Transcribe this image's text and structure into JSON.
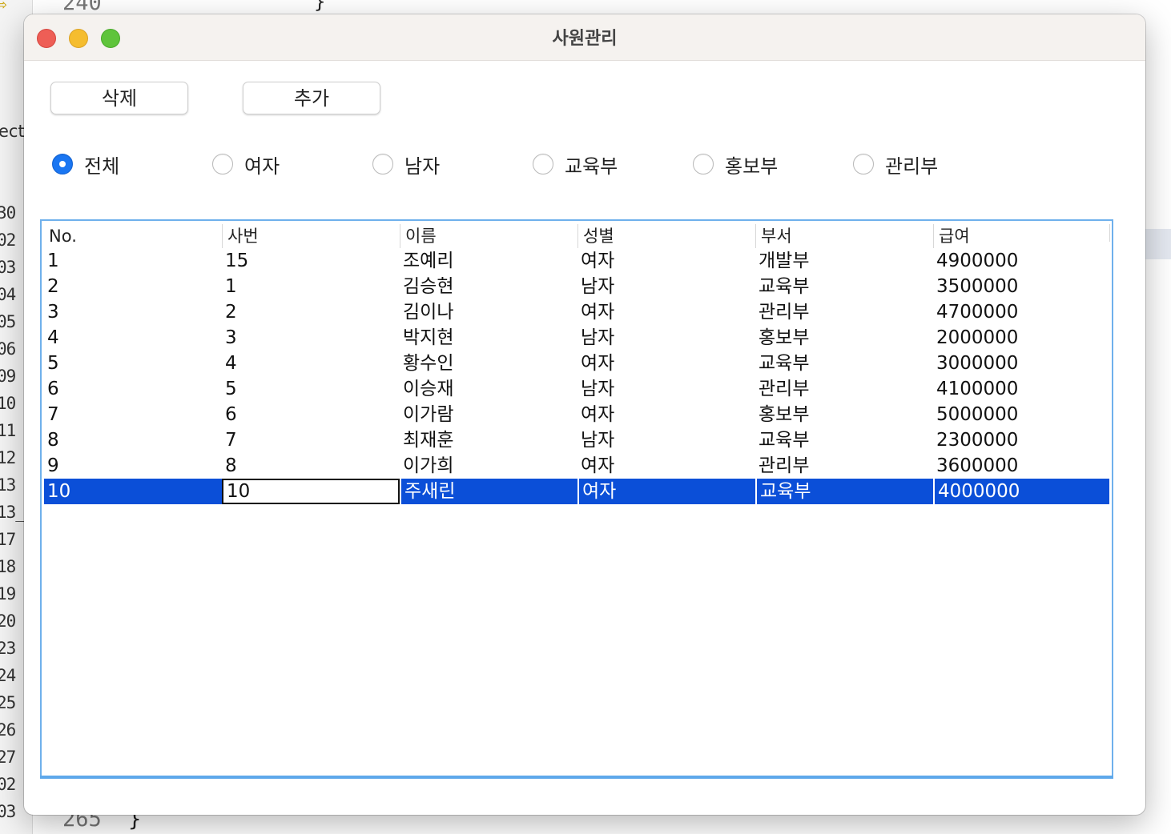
{
  "window": {
    "title": "사원관리"
  },
  "toolbar": {
    "delete_label": "삭제",
    "add_label": "추가"
  },
  "filters": [
    {
      "label": "전체",
      "checked": true
    },
    {
      "label": "여자",
      "checked": false
    },
    {
      "label": "남자",
      "checked": false
    },
    {
      "label": "교육부",
      "checked": false
    },
    {
      "label": "홍보부",
      "checked": false
    },
    {
      "label": "관리부",
      "checked": false
    }
  ],
  "table": {
    "columns": [
      "No.",
      "사번",
      "이름",
      "성별",
      "부서",
      "급여"
    ],
    "rows": [
      [
        "1",
        "15",
        "조예리",
        "여자",
        "개발부",
        "4900000"
      ],
      [
        "2",
        "1",
        "김승현",
        "남자",
        "교육부",
        "3500000"
      ],
      [
        "3",
        "2",
        "김이나",
        "여자",
        "관리부",
        "4700000"
      ],
      [
        "4",
        "3",
        "박지현",
        "남자",
        "홍보부",
        "2000000"
      ],
      [
        "5",
        "4",
        "황수인",
        "여자",
        "교육부",
        "3000000"
      ],
      [
        "6",
        "5",
        "이승재",
        "남자",
        "관리부",
        "4100000"
      ],
      [
        "7",
        "6",
        "이가람",
        "여자",
        "홍보부",
        "5000000"
      ],
      [
        "8",
        "7",
        "최재훈",
        "남자",
        "교육부",
        "2300000"
      ],
      [
        "9",
        "8",
        "이가희",
        "여자",
        "관리부",
        "3600000"
      ],
      [
        "10",
        "10",
        "주새린",
        "여자",
        "교육부",
        "4000000"
      ]
    ],
    "selected_row": 9,
    "editing_column": 1
  },
  "background_editor": {
    "gutter_word": "ect",
    "line_numbers": [
      "30",
      "02",
      "03",
      "04",
      "05",
      "06",
      "09",
      "10",
      "11",
      "12",
      "13",
      "13_",
      "17",
      "18",
      "19",
      "20",
      "23",
      "24",
      "25",
      "26",
      "27",
      "02",
      "03"
    ],
    "bottom_line_number": "265",
    "bottom_code": "}",
    "top_line_number": "240",
    "top_code": "}"
  }
}
